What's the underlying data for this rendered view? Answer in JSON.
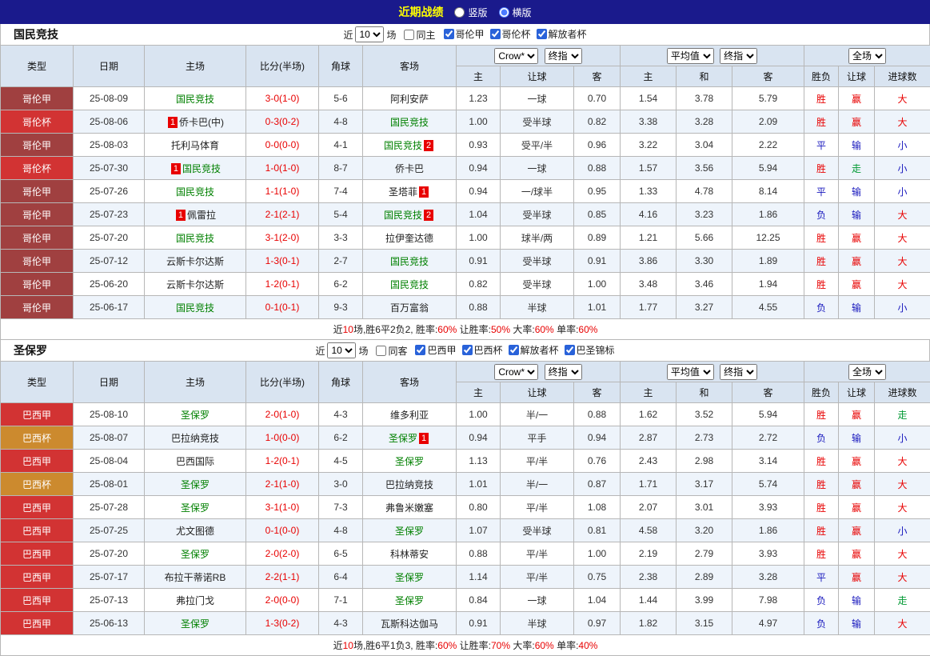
{
  "topbar": {
    "title": "近期战绩",
    "views": [
      {
        "label": "竖版",
        "selected": false
      },
      {
        "label": "横版",
        "selected": true
      }
    ]
  },
  "colors": {
    "胜": "#e80000",
    "平": "#1717bd",
    "负": "#1717bd",
    "赢": "#e80000",
    "输": "#1717bd",
    "走": "#009933",
    "大": "#e80000",
    "小": "#1717bd"
  },
  "type_colors": {
    "哥伦甲": "#a04040",
    "哥伦杯": "#d23333",
    "巴西甲": "#d23333",
    "巴西杯": "#cc8a2e"
  },
  "header_row": {
    "type": "类型",
    "date": "日期",
    "home": "主场",
    "score": "比分(半场)",
    "corner": "角球",
    "away": "客场",
    "asian": {
      "select1": "Crow*",
      "select2": "终指",
      "cols": [
        "主",
        "让球",
        "客"
      ]
    },
    "euro": {
      "select1": "平均值",
      "select2": "终指",
      "cols": [
        "主",
        "和",
        "客"
      ]
    },
    "result": {
      "select1": "全场",
      "cols": [
        "胜负",
        "让球",
        "进球数"
      ]
    }
  },
  "tables": [
    {
      "team": "国民竞技",
      "filter": {
        "near": "近",
        "count": "10",
        "games": "场",
        "same": {
          "label": "同主",
          "checked": false
        },
        "leagues": [
          {
            "label": "哥伦甲",
            "checked": true
          },
          {
            "label": "哥伦杯",
            "checked": true
          },
          {
            "label": "解放者杯",
            "checked": true
          }
        ]
      },
      "rows": [
        {
          "type": "哥伦甲",
          "date": "25-08-09",
          "home": {
            "text": "国民竞技",
            "team": true
          },
          "score": "3-0(1-0)",
          "corner": "5-6",
          "away": {
            "text": "阿利安萨"
          },
          "ah": [
            "1.23",
            "一球",
            "0.70"
          ],
          "eu": [
            "1.54",
            "3.78",
            "5.79"
          ],
          "res": [
            "胜",
            "赢",
            "大"
          ]
        },
        {
          "type": "哥伦杯",
          "date": "25-08-06",
          "home": {
            "text": "侨卡巴(中)",
            "badge_before": "1"
          },
          "score": "0-3(0-2)",
          "corner": "4-8",
          "away": {
            "text": "国民竞技",
            "team": true
          },
          "ah": [
            "1.00",
            "受半球",
            "0.82"
          ],
          "eu": [
            "3.38",
            "3.28",
            "2.09"
          ],
          "res": [
            "胜",
            "赢",
            "大"
          ]
        },
        {
          "type": "哥伦甲",
          "date": "25-08-03",
          "home": {
            "text": "托利马体育"
          },
          "score": "0-0(0-0)",
          "corner": "4-1",
          "away": {
            "text": "国民竞技",
            "team": true,
            "badge_after": "2"
          },
          "ah": [
            "0.93",
            "受平/半",
            "0.96"
          ],
          "eu": [
            "3.22",
            "3.04",
            "2.22"
          ],
          "res": [
            "平",
            "输",
            "小"
          ]
        },
        {
          "type": "哥伦杯",
          "date": "25-07-30",
          "home": {
            "text": "国民竞技",
            "team": true,
            "badge_before": "1"
          },
          "score": "1-0(1-0)",
          "corner": "8-7",
          "away": {
            "text": "侨卡巴"
          },
          "ah": [
            "0.94",
            "一球",
            "0.88"
          ],
          "eu": [
            "1.57",
            "3.56",
            "5.94"
          ],
          "res": [
            "胜",
            "走",
            "小"
          ]
        },
        {
          "type": "哥伦甲",
          "date": "25-07-26",
          "home": {
            "text": "国民竞技",
            "team": true
          },
          "score": "1-1(1-0)",
          "corner": "7-4",
          "away": {
            "text": "圣塔菲",
            "badge_after": "1"
          },
          "ah": [
            "0.94",
            "一/球半",
            "0.95"
          ],
          "eu": [
            "1.33",
            "4.78",
            "8.14"
          ],
          "res": [
            "平",
            "输",
            "小"
          ]
        },
        {
          "type": "哥伦甲",
          "date": "25-07-23",
          "home": {
            "text": "佩雷拉",
            "badge_before": "1"
          },
          "score": "2-1(2-1)",
          "corner": "5-4",
          "away": {
            "text": "国民竞技",
            "team": true,
            "badge_after": "2"
          },
          "ah": [
            "1.04",
            "受半球",
            "0.85"
          ],
          "eu": [
            "4.16",
            "3.23",
            "1.86"
          ],
          "res": [
            "负",
            "输",
            "大"
          ]
        },
        {
          "type": "哥伦甲",
          "date": "25-07-20",
          "home": {
            "text": "国民竞技",
            "team": true
          },
          "score": "3-1(2-0)",
          "corner": "3-3",
          "away": {
            "text": "拉伊奎达德"
          },
          "ah": [
            "1.00",
            "球半/两",
            "0.89"
          ],
          "eu": [
            "1.21",
            "5.66",
            "12.25"
          ],
          "res": [
            "胜",
            "赢",
            "大"
          ]
        },
        {
          "type": "哥伦甲",
          "date": "25-07-12",
          "home": {
            "text": "云斯卡尔达斯"
          },
          "score": "1-3(0-1)",
          "corner": "2-7",
          "away": {
            "text": "国民竞技",
            "team": true
          },
          "ah": [
            "0.91",
            "受半球",
            "0.91"
          ],
          "eu": [
            "3.86",
            "3.30",
            "1.89"
          ],
          "res": [
            "胜",
            "赢",
            "大"
          ]
        },
        {
          "type": "哥伦甲",
          "date": "25-06-20",
          "home": {
            "text": "云斯卡尔达斯"
          },
          "score": "1-2(0-1)",
          "corner": "6-2",
          "away": {
            "text": "国民竞技",
            "team": true
          },
          "ah": [
            "0.82",
            "受半球",
            "1.00"
          ],
          "eu": [
            "3.48",
            "3.46",
            "1.94"
          ],
          "res": [
            "胜",
            "赢",
            "大"
          ]
        },
        {
          "type": "哥伦甲",
          "date": "25-06-17",
          "home": {
            "text": "国民竞技",
            "team": true
          },
          "score": "0-1(0-1)",
          "corner": "9-3",
          "away": {
            "text": "百万富翁"
          },
          "ah": [
            "0.88",
            "半球",
            "1.01"
          ],
          "eu": [
            "1.77",
            "3.27",
            "4.55"
          ],
          "res": [
            "负",
            "输",
            "小"
          ]
        }
      ],
      "summary": [
        {
          "text": "近",
          "red": false
        },
        {
          "text": "10",
          "red": true
        },
        {
          "text": "场,胜6平2负2, 胜率:",
          "red": false
        },
        {
          "text": "60%",
          "red": true
        },
        {
          "text": " 让胜率:",
          "red": false
        },
        {
          "text": "50%",
          "red": true
        },
        {
          "text": " 大率:",
          "red": false
        },
        {
          "text": "60%",
          "red": true
        },
        {
          "text": " 单率:",
          "red": false
        },
        {
          "text": "60%",
          "red": true
        }
      ]
    },
    {
      "team": "圣保罗",
      "filter": {
        "near": "近",
        "count": "10",
        "games": "场",
        "same": {
          "label": "同客",
          "checked": false
        },
        "leagues": [
          {
            "label": "巴西甲",
            "checked": true
          },
          {
            "label": "巴西杯",
            "checked": true
          },
          {
            "label": "解放者杯",
            "checked": true
          },
          {
            "label": "巴圣锦标",
            "checked": true
          }
        ]
      },
      "rows": [
        {
          "type": "巴西甲",
          "date": "25-08-10",
          "home": {
            "text": "圣保罗",
            "team": true
          },
          "score": "2-0(1-0)",
          "corner": "4-3",
          "away": {
            "text": "维多利亚"
          },
          "ah": [
            "1.00",
            "半/一",
            "0.88"
          ],
          "eu": [
            "1.62",
            "3.52",
            "5.94"
          ],
          "res": [
            "胜",
            "赢",
            "走"
          ]
        },
        {
          "type": "巴西杯",
          "date": "25-08-07",
          "home": {
            "text": "巴拉纳竞技"
          },
          "score": "1-0(0-0)",
          "corner": "6-2",
          "away": {
            "text": "圣保罗",
            "team": true,
            "badge_after": "1"
          },
          "ah": [
            "0.94",
            "平手",
            "0.94"
          ],
          "eu": [
            "2.87",
            "2.73",
            "2.72"
          ],
          "res": [
            "负",
            "输",
            "小"
          ]
        },
        {
          "type": "巴西甲",
          "date": "25-08-04",
          "home": {
            "text": "巴西国际"
          },
          "score": "1-2(0-1)",
          "corner": "4-5",
          "away": {
            "text": "圣保罗",
            "team": true
          },
          "ah": [
            "1.13",
            "平/半",
            "0.76"
          ],
          "eu": [
            "2.43",
            "2.98",
            "3.14"
          ],
          "res": [
            "胜",
            "赢",
            "大"
          ]
        },
        {
          "type": "巴西杯",
          "date": "25-08-01",
          "home": {
            "text": "圣保罗",
            "team": true
          },
          "score": "2-1(1-0)",
          "corner": "3-0",
          "away": {
            "text": "巴拉纳竞技"
          },
          "ah": [
            "1.01",
            "半/一",
            "0.87"
          ],
          "eu": [
            "1.71",
            "3.17",
            "5.74"
          ],
          "res": [
            "胜",
            "赢",
            "大"
          ]
        },
        {
          "type": "巴西甲",
          "date": "25-07-28",
          "home": {
            "text": "圣保罗",
            "team": true
          },
          "score": "3-1(1-0)",
          "corner": "7-3",
          "away": {
            "text": "弗鲁米嫩塞"
          },
          "ah": [
            "0.80",
            "平/半",
            "1.08"
          ],
          "eu": [
            "2.07",
            "3.01",
            "3.93"
          ],
          "res": [
            "胜",
            "赢",
            "大"
          ]
        },
        {
          "type": "巴西甲",
          "date": "25-07-25",
          "home": {
            "text": "尤文图德"
          },
          "score": "0-1(0-0)",
          "corner": "4-8",
          "away": {
            "text": "圣保罗",
            "team": true
          },
          "ah": [
            "1.07",
            "受半球",
            "0.81"
          ],
          "eu": [
            "4.58",
            "3.20",
            "1.86"
          ],
          "res": [
            "胜",
            "赢",
            "小"
          ]
        },
        {
          "type": "巴西甲",
          "date": "25-07-20",
          "home": {
            "text": "圣保罗",
            "team": true
          },
          "score": "2-0(2-0)",
          "corner": "6-5",
          "away": {
            "text": "科林蒂安"
          },
          "ah": [
            "0.88",
            "平/半",
            "1.00"
          ],
          "eu": [
            "2.19",
            "2.79",
            "3.93"
          ],
          "res": [
            "胜",
            "赢",
            "大"
          ]
        },
        {
          "type": "巴西甲",
          "date": "25-07-17",
          "home": {
            "text": "布拉干蒂诺RB"
          },
          "score": "2-2(1-1)",
          "corner": "6-4",
          "away": {
            "text": "圣保罗",
            "team": true
          },
          "ah": [
            "1.14",
            "平/半",
            "0.75"
          ],
          "eu": [
            "2.38",
            "2.89",
            "3.28"
          ],
          "res": [
            "平",
            "赢",
            "大"
          ]
        },
        {
          "type": "巴西甲",
          "date": "25-07-13",
          "home": {
            "text": "弗拉门戈"
          },
          "score": "2-0(0-0)",
          "corner": "7-1",
          "away": {
            "text": "圣保罗",
            "team": true
          },
          "ah": [
            "0.84",
            "一球",
            "1.04"
          ],
          "eu": [
            "1.44",
            "3.99",
            "7.98"
          ],
          "res": [
            "负",
            "输",
            "走"
          ]
        },
        {
          "type": "巴西甲",
          "date": "25-06-13",
          "home": {
            "text": "圣保罗",
            "team": true
          },
          "score": "1-3(0-2)",
          "corner": "4-3",
          "away": {
            "text": "瓦斯科达伽马"
          },
          "ah": [
            "0.91",
            "半球",
            "0.97"
          ],
          "eu": [
            "1.82",
            "3.15",
            "4.97"
          ],
          "res": [
            "负",
            "输",
            "大"
          ]
        }
      ],
      "summary": [
        {
          "text": "近",
          "red": false
        },
        {
          "text": "10",
          "red": true
        },
        {
          "text": "场,胜6平1负3, 胜率:",
          "red": false
        },
        {
          "text": "60%",
          "red": true
        },
        {
          "text": " 让胜率:",
          "red": false
        },
        {
          "text": "70%",
          "red": true
        },
        {
          "text": " 大率:",
          "red": false
        },
        {
          "text": "60%",
          "red": true
        },
        {
          "text": " 单率:",
          "red": false
        },
        {
          "text": "40%",
          "red": true
        }
      ]
    }
  ]
}
